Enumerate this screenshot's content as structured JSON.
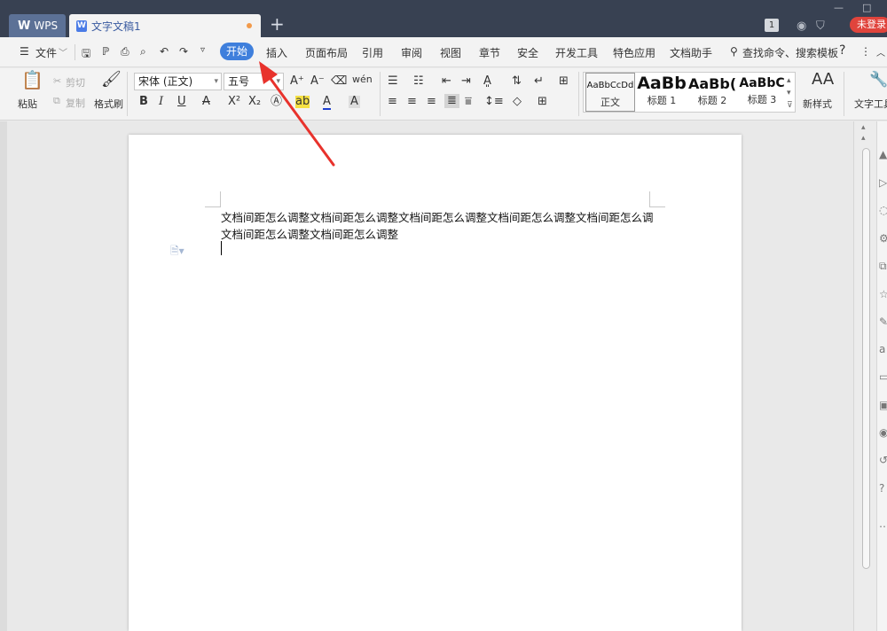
{
  "titlebar": {
    "wps_tab": "WPS",
    "doc_tab": "文字文稿1",
    "new_tab": "+",
    "count_badge": "1",
    "login": "未登录",
    "minimize": "—",
    "maximize": "□"
  },
  "menu": {
    "file": "文件",
    "start": "开始",
    "insert": "插入",
    "layout": "页面布局",
    "references": "引用",
    "review": "审阅",
    "view": "视图",
    "chapter": "章节",
    "security": "安全",
    "devtools": "开发工具",
    "features": "特色应用",
    "assistant": "文档助手",
    "search": "查找命令、搜索模板",
    "help": "?"
  },
  "ribbon": {
    "paste": "粘贴",
    "cut": "剪切",
    "copy": "复制",
    "format_painter": "格式刷",
    "font_name": "宋体 (正文)",
    "font_size": "五号",
    "styles": [
      {
        "sample": "AaBbCcDd",
        "name": "正文"
      },
      {
        "sample": "AaBb",
        "name": "标题 1"
      },
      {
        "sample": "AaBb(",
        "name": "标题 2"
      },
      {
        "sample": "AaBbC",
        "name": "标题 3"
      }
    ],
    "new_style": "新样式",
    "text_tools": "文字工具"
  },
  "document": {
    "line1": "文档间距怎么调整文档间距怎么调整文档间距怎么调整文档间距怎么调整文档间距怎么调",
    "line2": "文档间距怎么调整文档间距怎么调整"
  },
  "colors": {
    "titlebar": "#384152",
    "accent": "#3f7fdc",
    "login_red": "#e0443c",
    "annotation_arrow": "#e8322c"
  }
}
